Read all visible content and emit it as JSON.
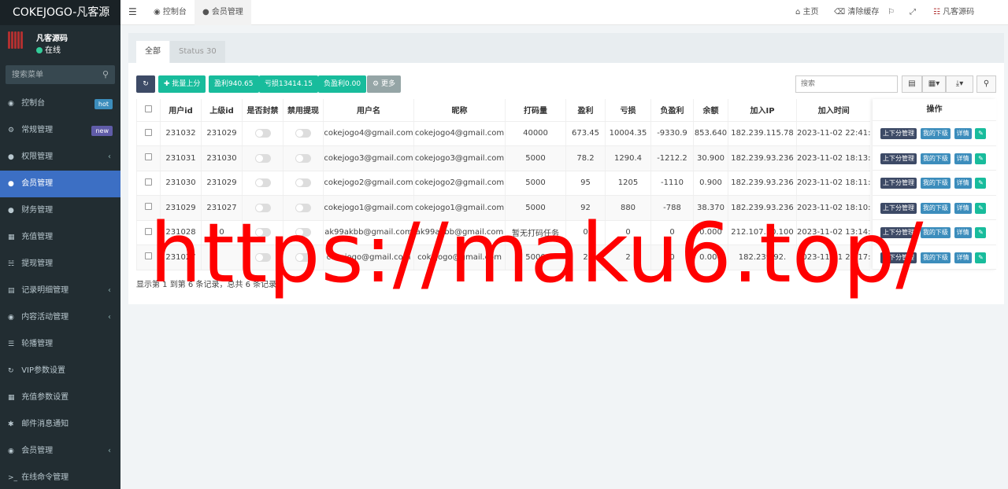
{
  "brand": "COKEJOGO-凡客源",
  "user": {
    "name": "凡客源码",
    "status": "在线"
  },
  "search": {
    "placeholder": "搜索菜单"
  },
  "menu": [
    {
      "label": "控制台",
      "icon": "dashboard-icon",
      "badge": "hot"
    },
    {
      "label": "常规管理",
      "icon": "cogs-icon",
      "badge": "new"
    },
    {
      "label": "权限管理",
      "icon": "users-icon"
    },
    {
      "label": "会员管理",
      "icon": "users-icon",
      "active": true
    },
    {
      "label": "财务管理",
      "icon": "users-icon"
    },
    {
      "label": "充值管理",
      "icon": "grid-icon"
    },
    {
      "label": "提现管理",
      "icon": "bank-icon"
    },
    {
      "label": "记录明细管理",
      "icon": "chart-icon"
    },
    {
      "label": "内容活动管理",
      "icon": "globe-icon"
    },
    {
      "label": "轮播管理",
      "icon": "bars-icon"
    },
    {
      "label": "VIP参数设置",
      "icon": "refresh-icon"
    },
    {
      "label": "充值参数设置",
      "icon": "grid-icon"
    },
    {
      "label": "邮件消息通知",
      "icon": "asterisk-icon"
    },
    {
      "label": "会员管理",
      "icon": "user-circle-icon"
    },
    {
      "label": "在线命令管理",
      "icon": "terminal-icon"
    }
  ],
  "topbar": {
    "tabs": [
      "控制台",
      "会员管理"
    ],
    "home": "主页",
    "clear_cache": "清除缓存",
    "admin_name": "凡客源码"
  },
  "tabs": [
    "全部",
    "Status 30"
  ],
  "toolbar": {
    "batch": "批量上分",
    "profit": "盈利940.65",
    "loss": "亏损13414.15",
    "neg": "负盈利0.00",
    "more": "更多",
    "search_placeholder": "搜索"
  },
  "table": {
    "headers": [
      "用户id",
      "上级id",
      "是否封禁",
      "禁用提现",
      "用户名",
      "昵称",
      "打码量",
      "盈利",
      "亏损",
      "负盈利",
      "余额",
      "加入IP",
      "加入时间"
    ],
    "rows": [
      [
        "231032",
        "231029",
        "",
        "",
        "cokejogo4@gmail.com",
        "cokejogo4@gmail.com",
        "40000",
        "673.45",
        "10004.35",
        "-9330.9",
        "853.640",
        "182.239.115.78",
        "2023-11-02 22:41:"
      ],
      [
        "231031",
        "231030",
        "",
        "",
        "cokejogo3@gmail.com",
        "cokejogo3@gmail.com",
        "5000",
        "78.2",
        "1290.4",
        "-1212.2",
        "30.900",
        "182.239.93.236",
        "2023-11-02 18:13:"
      ],
      [
        "231030",
        "231029",
        "",
        "",
        "cokejogo2@gmail.com",
        "cokejogo2@gmail.com",
        "5000",
        "95",
        "1205",
        "-1110",
        "0.900",
        "182.239.93.236",
        "2023-11-02 18:11:"
      ],
      [
        "231029",
        "231027",
        "",
        "",
        "cokejogo1@gmail.com",
        "cokejogo1@gmail.com",
        "5000",
        "92",
        "880",
        "-788",
        "38.370",
        "182.239.93.236",
        "2023-11-02 18:10:"
      ],
      [
        "231028",
        "0",
        "",
        "",
        "ak99akbb@gmail.com",
        "ak99akbb@gmail.com",
        "暂无打码任务",
        "0",
        "0",
        "0",
        "0.000",
        "212.107.30.100",
        "2023-11-02 13:14:"
      ],
      [
        "231027",
        "",
        "",
        "",
        "cokejogo@gmail.com",
        "cokejogo@gmail.com",
        "5000",
        "2",
        "2",
        "0",
        "0.000",
        "182.239.92.",
        "2023-11-01 21:17:"
      ]
    ]
  },
  "ops": {
    "header": "操作",
    "b1": "上下分管理",
    "b2": "我的下级",
    "b3": "详情"
  },
  "footer": "显示第 1 到第 6 条记录，总共 6 条记录",
  "watermark": "https://maku6.top/"
}
